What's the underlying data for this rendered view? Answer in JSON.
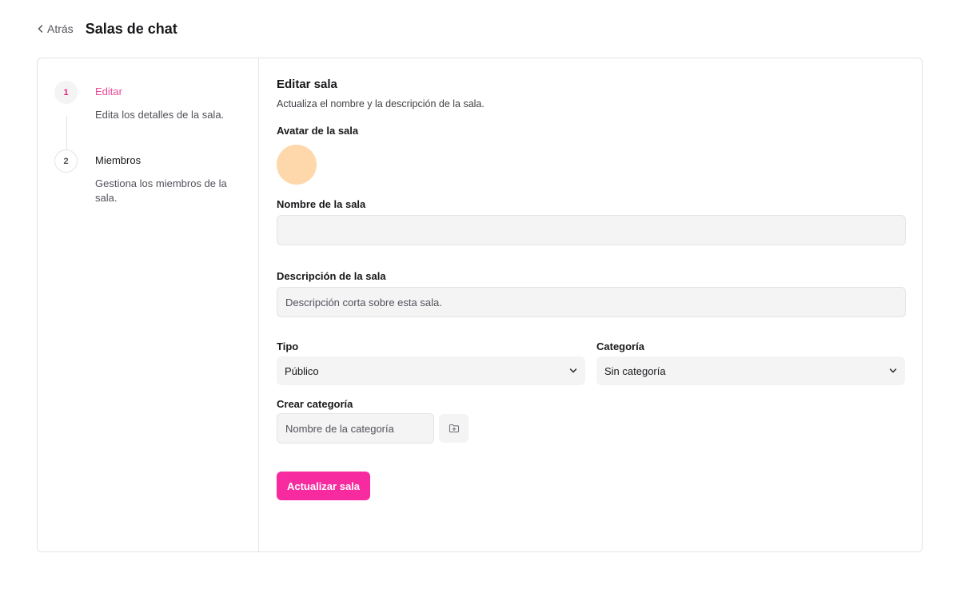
{
  "header": {
    "back_label": "Atrás",
    "title": "Salas de chat"
  },
  "steps": [
    {
      "number": "1",
      "title": "Editar",
      "description": "Edita los detalles de la sala.",
      "active": true
    },
    {
      "number": "2",
      "title": "Miembros",
      "description": "Gestiona los miembros de la sala.",
      "active": false
    }
  ],
  "form": {
    "title": "Editar sala",
    "subtitle": "Actualiza el nombre y la descripción de la sala.",
    "avatar_label": "Avatar de la sala",
    "avatar_color": "#fed7aa",
    "name_label": "Nombre de la sala",
    "name_value": "",
    "description_label": "Descripción de la sala",
    "description_placeholder": "Descripción corta sobre esta sala.",
    "type_label": "Tipo",
    "type_value": "Público",
    "category_label": "Categoría",
    "category_value": "Sin categoría",
    "create_category_label": "Crear categoría",
    "create_category_placeholder": "Nombre de la categoría",
    "submit_label": "Actualizar sala"
  },
  "colors": {
    "accent": "#f72a9f",
    "accent_text": "#ec4899"
  },
  "icons": {
    "back": "chevron-left-icon",
    "select": "chevron-down-icon",
    "folder": "folder-plus-icon"
  }
}
